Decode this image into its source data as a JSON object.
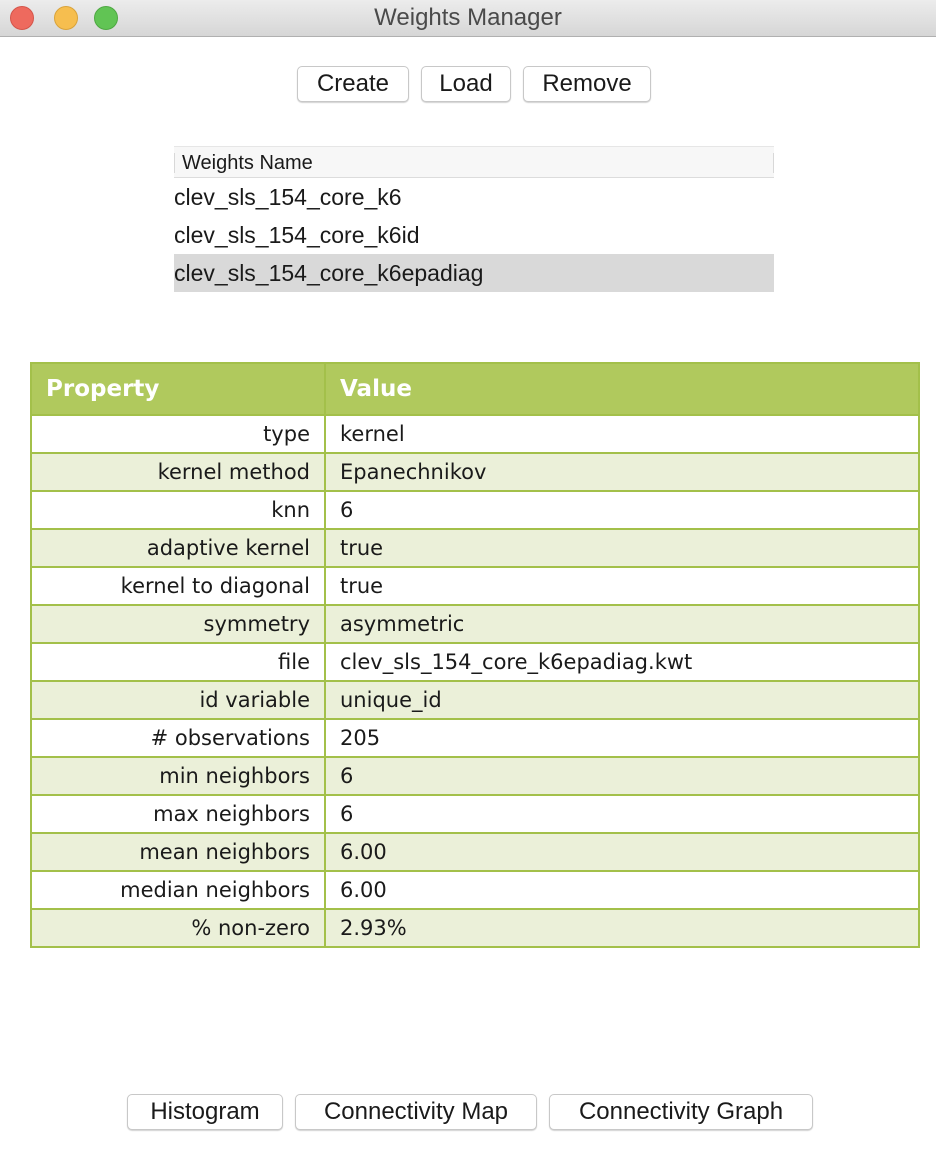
{
  "window": {
    "title": "Weights Manager"
  },
  "toolbar": {
    "create_label": "Create",
    "load_label": "Load",
    "remove_label": "Remove"
  },
  "weights_list": {
    "header": "Weights Name",
    "items": [
      {
        "name": "clev_sls_154_core_k6",
        "selected": false
      },
      {
        "name": "clev_sls_154_core_k6id",
        "selected": false
      },
      {
        "name": "clev_sls_154_core_k6epadiag",
        "selected": true
      }
    ]
  },
  "properties": {
    "headers": [
      "Property",
      "Value"
    ],
    "rows": [
      {
        "property": "type",
        "value": "kernel"
      },
      {
        "property": "kernel method",
        "value": "Epanechnikov"
      },
      {
        "property": "knn",
        "value": "6"
      },
      {
        "property": "adaptive kernel",
        "value": "true"
      },
      {
        "property": "kernel to diagonal",
        "value": "true"
      },
      {
        "property": "symmetry",
        "value": "asymmetric"
      },
      {
        "property": "file",
        "value": "clev_sls_154_core_k6epadiag.kwt"
      },
      {
        "property": "id variable",
        "value": "unique_id"
      },
      {
        "property": "# observations",
        "value": "205"
      },
      {
        "property": "min neighbors",
        "value": "6"
      },
      {
        "property": "max neighbors",
        "value": "6"
      },
      {
        "property": "mean neighbors",
        "value": "6.00"
      },
      {
        "property": "median neighbors",
        "value": "6.00"
      },
      {
        "property": "% non-zero",
        "value": "2.93%"
      }
    ]
  },
  "bottom_buttons": {
    "histogram_label": "Histogram",
    "connectivity_map_label": "Connectivity Map",
    "connectivity_graph_label": "Connectivity Graph"
  },
  "colors": {
    "table_header": "#b0c95d",
    "table_border": "#a3c04a",
    "table_alt_row": "#ebf0d9",
    "list_selected": "#d9d9d9"
  }
}
